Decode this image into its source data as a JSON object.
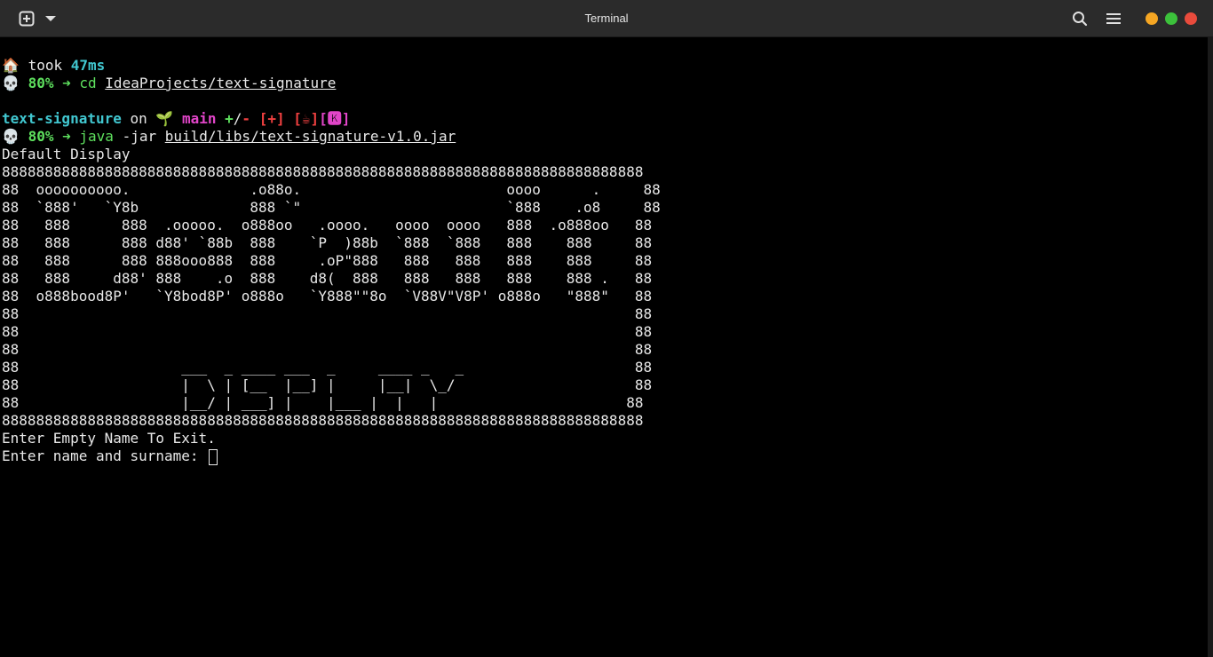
{
  "window": {
    "title": "Terminal",
    "icons": {
      "new_tab": "new-tab-icon",
      "dropdown": "chevron-down-icon",
      "search": "search-icon",
      "menu": "hamburger-menu-icon"
    },
    "colors": {
      "minimize": "#f5a623",
      "maximize": "#3cc13b",
      "close": "#e94b3c"
    }
  },
  "prompt1": {
    "house": "🏠",
    "took_label": "took",
    "duration": "47ms",
    "skull": "💀",
    "percent": "80%",
    "arrow": "➜",
    "command": "cd",
    "arg": "IdeaProjects/text-signature"
  },
  "prompt2": {
    "dir": "text-signature",
    "on": "on",
    "branch_icon": "🌱",
    "branch": "main",
    "plus": "+",
    "slash": "/",
    "minus": "-",
    "status": "[+]",
    "java_badge": "[☕]",
    "kotlin_badge": "[🅺]",
    "skull": "💀",
    "percent": "80%",
    "arrow": "➜",
    "command": "java",
    "flag": "-jar",
    "arg": "build/libs/text-signature-v1.0.jar"
  },
  "output": {
    "header": "Default Display",
    "art_lines": [
      "888888888888888888888888888888888888888888888888888888888888888888888888888",
      "88  oooooooooo.              .o88o.                        oooo      .     88",
      "88  `888'   `Y8b             888 `\"                        `888    .o8     88",
      "88   888      888  .ooooo.  o888oo   .oooo.   oooo  oooo   888  .o888oo   88",
      "88   888      888 d88' `88b  888    `P  )88b  `888  `888   888    888     88",
      "88   888      888 888ooo888  888     .oP\"888   888   888   888    888     88",
      "88   888     d88' 888    .o  888    d8(  888   888   888   888    888 .   88",
      "88  o888bood8P'   `Y8bod8P' o888o   `Y888\"\"8o  `V88V\"V8P' o888o   \"888\"   88",
      "88                                                                        88",
      "88                                                                        88",
      "88                                                                        88",
      "88                   ___  _ ____ ___  _     ____ _   _                    88",
      "88                   |  \\ | [__  |__] |     |__|  \\_/                     88",
      "88                   |__/ | ___] |    |___ |  |   |                      88",
      "888888888888888888888888888888888888888888888888888888888888888888888888888"
    ],
    "exit_hint": "Enter Empty Name To Exit.",
    "input_prompt": "Enter name and surname: ",
    "input_value": ""
  }
}
